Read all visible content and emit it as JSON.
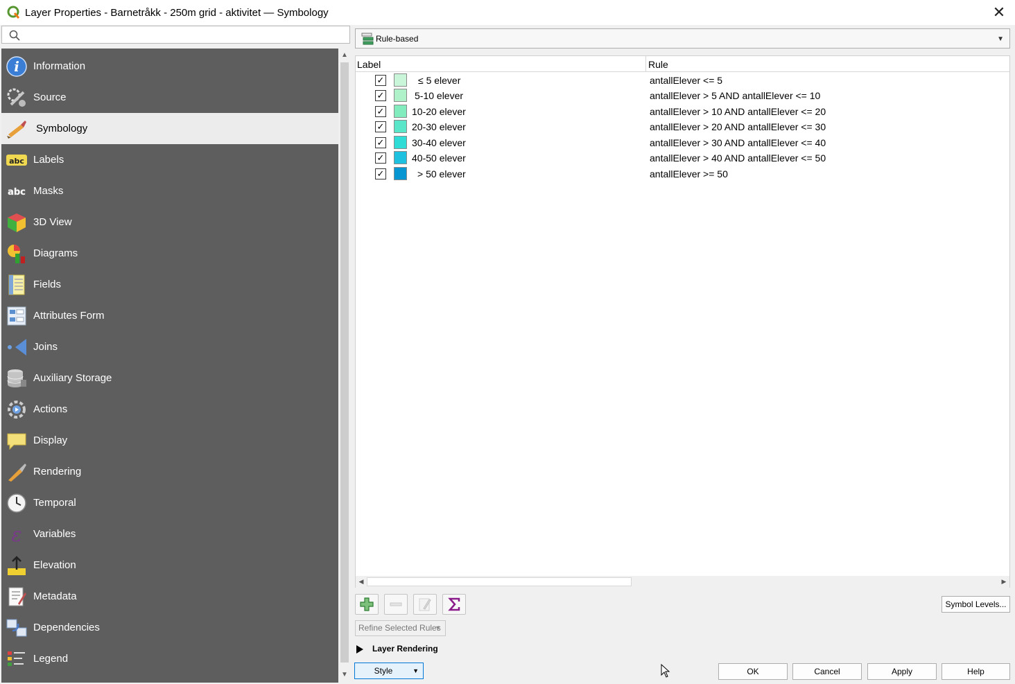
{
  "window": {
    "title": "Layer Properties - Barnetråkk - 250m grid - aktivitet — Symbology",
    "close_glyph": "✕"
  },
  "search": {
    "placeholder": ""
  },
  "sidebar": {
    "items": [
      {
        "label": "Information",
        "icon": "info-icon"
      },
      {
        "label": "Source",
        "icon": "source-icon"
      },
      {
        "label": "Symbology",
        "icon": "symbology-icon"
      },
      {
        "label": "Labels",
        "icon": "labels-icon"
      },
      {
        "label": "Masks",
        "icon": "masks-icon"
      },
      {
        "label": "3D View",
        "icon": "3d-view-icon"
      },
      {
        "label": "Diagrams",
        "icon": "diagrams-icon"
      },
      {
        "label": "Fields",
        "icon": "fields-icon"
      },
      {
        "label": "Attributes Form",
        "icon": "attributes-form-icon"
      },
      {
        "label": "Joins",
        "icon": "joins-icon"
      },
      {
        "label": "Auxiliary Storage",
        "icon": "auxiliary-storage-icon"
      },
      {
        "label": "Actions",
        "icon": "actions-icon"
      },
      {
        "label": "Display",
        "icon": "display-icon"
      },
      {
        "label": "Rendering",
        "icon": "rendering-icon"
      },
      {
        "label": "Temporal",
        "icon": "temporal-icon"
      },
      {
        "label": "Variables",
        "icon": "variables-icon"
      },
      {
        "label": "Elevation",
        "icon": "elevation-icon"
      },
      {
        "label": "Metadata",
        "icon": "metadata-icon"
      },
      {
        "label": "Dependencies",
        "icon": "dependencies-icon"
      },
      {
        "label": "Legend",
        "icon": "legend-icon"
      }
    ],
    "active": "Symbology"
  },
  "renderer": {
    "selected": "Rule-based"
  },
  "rules_table": {
    "columns": [
      "Label",
      "Rule"
    ],
    "rows": [
      {
        "checked": true,
        "color": "#c9f5d9",
        "label": "≤ 5 elever",
        "rule": "antallElever <= 5"
      },
      {
        "checked": true,
        "color": "#aff2c9",
        "label": "5-10 elever",
        "rule": "antallElever > 5 AND antallElever <= 10"
      },
      {
        "checked": true,
        "color": "#82ecbf",
        "label": "10-20 elever",
        "rule": "antallElever > 10 AND antallElever <= 20"
      },
      {
        "checked": true,
        "color": "#5ae6c8",
        "label": "20-30 elever",
        "rule": "antallElever > 20 AND antallElever <= 30"
      },
      {
        "checked": true,
        "color": "#30ddd6",
        "label": "30-40 elever",
        "rule": "antallElever > 30 AND antallElever <= 40"
      },
      {
        "checked": true,
        "color": "#1ec2e0",
        "label": "40-50 elever",
        "rule": "antallElever > 40 AND antallElever <= 50"
      },
      {
        "checked": true,
        "color": "#0896d2",
        "label": "> 50 elever",
        "rule": "antallElever >= 50"
      }
    ]
  },
  "toolbar": {
    "symbol_levels": "Symbol Levels...",
    "refine": "Refine Selected Rules"
  },
  "layer_rendering": {
    "label": "Layer Rendering"
  },
  "footer": {
    "style": "Style",
    "ok": "OK",
    "cancel": "Cancel",
    "apply": "Apply",
    "help": "Help"
  }
}
